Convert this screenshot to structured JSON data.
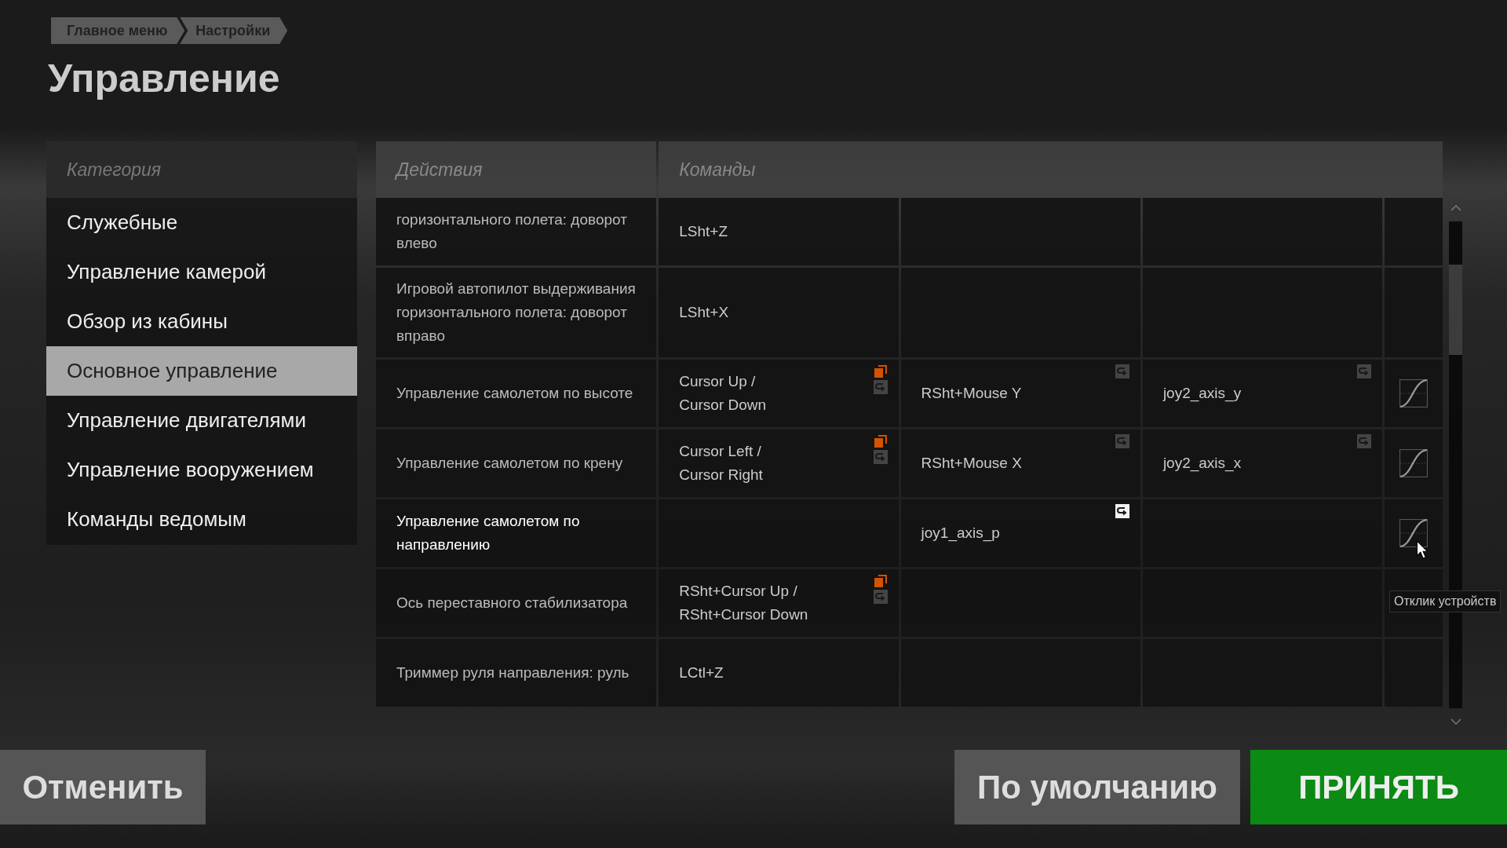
{
  "breadcrumb": [
    "Главное меню",
    "Настройки"
  ],
  "title": "Управление",
  "categories": {
    "header": "Категория",
    "items": [
      {
        "label": "Служебные",
        "selected": false
      },
      {
        "label": "Управление камерой",
        "selected": false
      },
      {
        "label": "Обзор из кабины",
        "selected": false
      },
      {
        "label": "Основное управление",
        "selected": true
      },
      {
        "label": "Управление двигателями",
        "selected": false
      },
      {
        "label": "Управление вооружением",
        "selected": false
      },
      {
        "label": "Команды ведомым",
        "selected": false
      }
    ]
  },
  "table": {
    "columns": [
      "Действия",
      "Команды"
    ],
    "rows": [
      {
        "hovered": false,
        "cells": [
          {
            "kind": "action",
            "text": "горизонтального полета: доворот влево"
          },
          {
            "kind": "binding",
            "text": "LSht+Z"
          },
          {
            "kind": "binding"
          },
          {
            "kind": "binding"
          },
          {
            "kind": "blank"
          }
        ]
      },
      {
        "hovered": false,
        "cells": [
          {
            "kind": "action",
            "text": "Игровой автопилот выдерживания горизонтального полета: доворот вправо"
          },
          {
            "kind": "binding",
            "text": "LSht+X"
          },
          {
            "kind": "binding"
          },
          {
            "kind": "binding"
          },
          {
            "kind": "blank"
          }
        ]
      },
      {
        "hovered": false,
        "cells": [
          {
            "kind": "action",
            "text": "Управление самолетом по высоте"
          },
          {
            "kind": "binding",
            "text": "Cursor Up /\nCursor Down",
            "marks": [
              {
                "kind": "conflict"
              },
              {
                "kind": "reset",
                "highlighted": false
              }
            ]
          },
          {
            "kind": "binding",
            "text": "RSht+Mouse Y",
            "marks": [
              {
                "kind": "reset",
                "highlighted": false
              }
            ]
          },
          {
            "kind": "binding",
            "text": "joy2_axis_y",
            "marks": [
              {
                "kind": "reset",
                "highlighted": false
              }
            ]
          },
          {
            "kind": "curve"
          }
        ]
      },
      {
        "hovered": false,
        "cells": [
          {
            "kind": "action",
            "text": "Управление самолетом по крену"
          },
          {
            "kind": "binding",
            "text": "Cursor Left /\nCursor Right",
            "marks": [
              {
                "kind": "conflict"
              },
              {
                "kind": "reset",
                "highlighted": false
              }
            ]
          },
          {
            "kind": "binding",
            "text": "RSht+Mouse X",
            "marks": [
              {
                "kind": "reset",
                "highlighted": false
              }
            ]
          },
          {
            "kind": "binding",
            "text": "joy2_axis_x",
            "marks": [
              {
                "kind": "reset",
                "highlighted": false
              }
            ]
          },
          {
            "kind": "curve"
          }
        ]
      },
      {
        "hovered": true,
        "cells": [
          {
            "kind": "action",
            "text": "Управление самолетом по направлению"
          },
          {
            "kind": "binding"
          },
          {
            "kind": "binding",
            "text": "joy1_axis_p",
            "marks": [
              {
                "kind": "reset",
                "highlighted": true
              }
            ]
          },
          {
            "kind": "binding"
          },
          {
            "kind": "curve"
          }
        ]
      },
      {
        "hovered": false,
        "cells": [
          {
            "kind": "action",
            "text": "Ось переставного стабилизатора"
          },
          {
            "kind": "binding",
            "text": "RSht+Cursor Up /\nRSht+Cursor Down",
            "marks": [
              {
                "kind": "conflict"
              },
              {
                "kind": "reset",
                "highlighted": false
              }
            ]
          },
          {
            "kind": "binding"
          },
          {
            "kind": "binding"
          },
          {
            "kind": "blank"
          }
        ]
      },
      {
        "hovered": false,
        "cells": [
          {
            "kind": "action",
            "text": "Триммер руля направления: руль"
          },
          {
            "kind": "binding",
            "text": "LCtl+Z"
          },
          {
            "kind": "binding"
          },
          {
            "kind": "binding"
          },
          {
            "kind": "blank"
          }
        ]
      }
    ]
  },
  "tooltip": "Отклик устройств",
  "buttons": {
    "cancel": "Отменить",
    "defaults": "По умолчанию",
    "accept": "ПРИНЯТЬ"
  }
}
